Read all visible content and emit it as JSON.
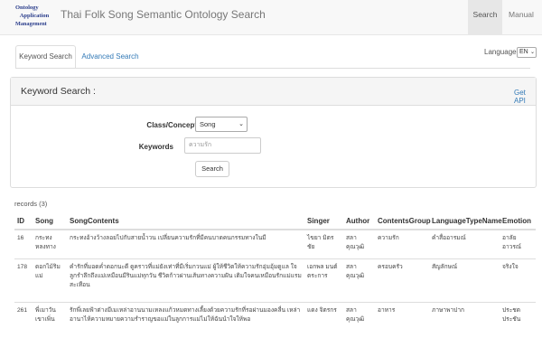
{
  "header": {
    "logo_lines": [
      "Ontology",
      "Application",
      "Management"
    ],
    "brand": "Thai Folk Song Semantic Ontology Search",
    "nav": {
      "search": "Search",
      "manual": "Manual"
    }
  },
  "tabs": {
    "keyword": "Keyword Search",
    "advanced": "Advanced Search"
  },
  "language": {
    "label": "Language:",
    "value": "EN"
  },
  "search_panel": {
    "title": "Keyword Search :",
    "get_api": "Get API",
    "class_label": "Class/Concept",
    "class_value": "Song",
    "keywords_label": "Keywords",
    "keywords_value": "ความรัก",
    "search_button": "Search"
  },
  "results": {
    "records_label": "records (3)",
    "columns": [
      "ID",
      "Song",
      "SongContents",
      "Singer",
      "Author",
      "ContentsGroup",
      "LanguageTypeName",
      "Emotion"
    ],
    "rows": [
      {
        "id": "16",
        "song": "กระทง หลงทาง",
        "contents": "กระทงอ้างว้างลอยไปกับสายน้ำวน เปลี่ยนความรักที่มีคนบาดคนกรรมทางในมี",
        "singer": "ไขยา มิตร ชัย",
        "author": "สลา คุณวุฒิ",
        "group": "ความรัก",
        "langtype": "คำสื่ออารมณ์",
        "emotion": "อาลัย อาวรณ์"
      },
      {
        "id": "178",
        "song": "ดอกไม้ริม แม่",
        "contents": "คำรักที่มอดค่ำดอกนะดี ดูคราวที่แม่ยังเท่าที่มีเริ่มกวนแม่ ผู้ให้ชีวิตให้ความรักอุ่มอุ้มดูแล ใจลูกรำลึกถึงแม่เหมือนมีรินแม่ทุกวัน ชีวิตก้าวผ่านเส้นทางความฝัน เติมใจคนเหมือนรักแม่แรมสะเทือน",
        "singer": "เอกพล มนต์ ตระการ",
        "author": "สลา คุณวุฒิ",
        "group": "ครอบครัว",
        "langtype": "สัญลักษณ์",
        "emotion": "จริงใจ"
      },
      {
        "id": "261",
        "song": "พี่เมาวัน เขาเพิ่น",
        "contents": "รักพี่เลยฟ้าต่างมีเมเหล่าอานนามเหลงแก้วหมดทางเลี้ยงด้วยความรักที่รอผ่านมองคลื่น เหล่าอานาไห้ความหมายความรำราญขอแม่ในลูกการแม่ไม่ให้ฉันนำใจให้พอ",
        "singer": "แดง จิตรกร",
        "author": "สลา คุณวุฒิ",
        "group": "อาหาร",
        "langtype": "ภาษาพาปาก",
        "emotion": "ประชด ประชัน"
      }
    ]
  },
  "colors": {
    "link": "#337ab7",
    "logo": "#2b3e8c",
    "navbar": "#f8f8f8"
  }
}
